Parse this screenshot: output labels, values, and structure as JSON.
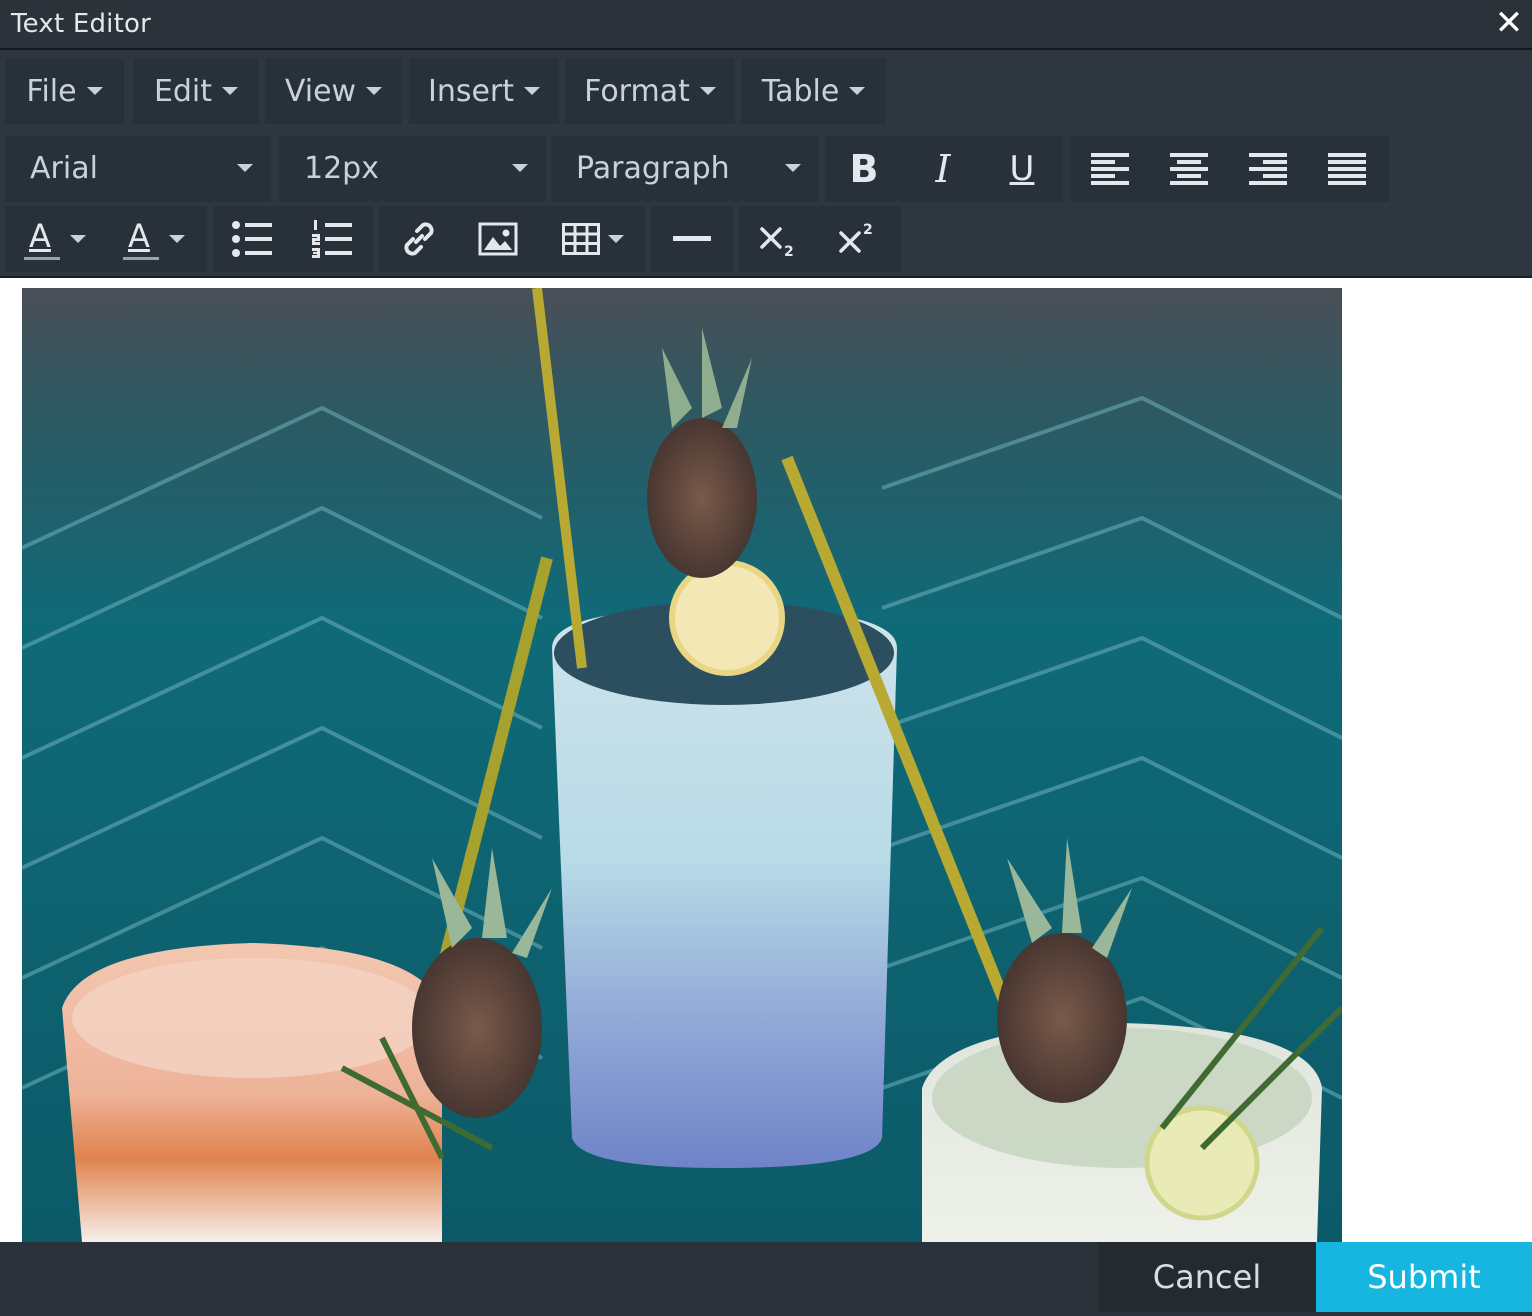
{
  "window": {
    "title": "Text Editor",
    "close_glyph": "✕"
  },
  "menubar": {
    "items": [
      {
        "label": "File"
      },
      {
        "label": "Edit"
      },
      {
        "label": "View"
      },
      {
        "label": "Insert"
      },
      {
        "label": "Format"
      },
      {
        "label": "Table"
      }
    ]
  },
  "format_toolbar": {
    "font_family": "Arial",
    "font_size": "12px",
    "block_format": "Paragraph",
    "bold_glyph": "B",
    "italic_glyph": "I",
    "underline_glyph": "U",
    "text_color_glyph": "A",
    "background_color_glyph": "A"
  },
  "icons": [
    "close-icon",
    "chevron-down-icon",
    "bold-icon",
    "italic-icon",
    "underline-icon",
    "align-left-icon",
    "align-center-icon",
    "align-right-icon",
    "align-justify-icon",
    "text-color-icon",
    "background-color-icon",
    "bullet-list-icon",
    "numbered-list-icon",
    "link-icon",
    "image-icon",
    "table-icon",
    "horizontal-rule-icon",
    "subscript-icon",
    "superscript-icon"
  ],
  "footer": {
    "cancel_label": "Cancel",
    "submit_label": "Submit"
  },
  "colors": {
    "titlebar": "#2b323a",
    "toolbar": "#2e373f",
    "button_group": "#28313a",
    "submit_accent": "#16b6e0",
    "cancel_bg": "#242a30"
  }
}
